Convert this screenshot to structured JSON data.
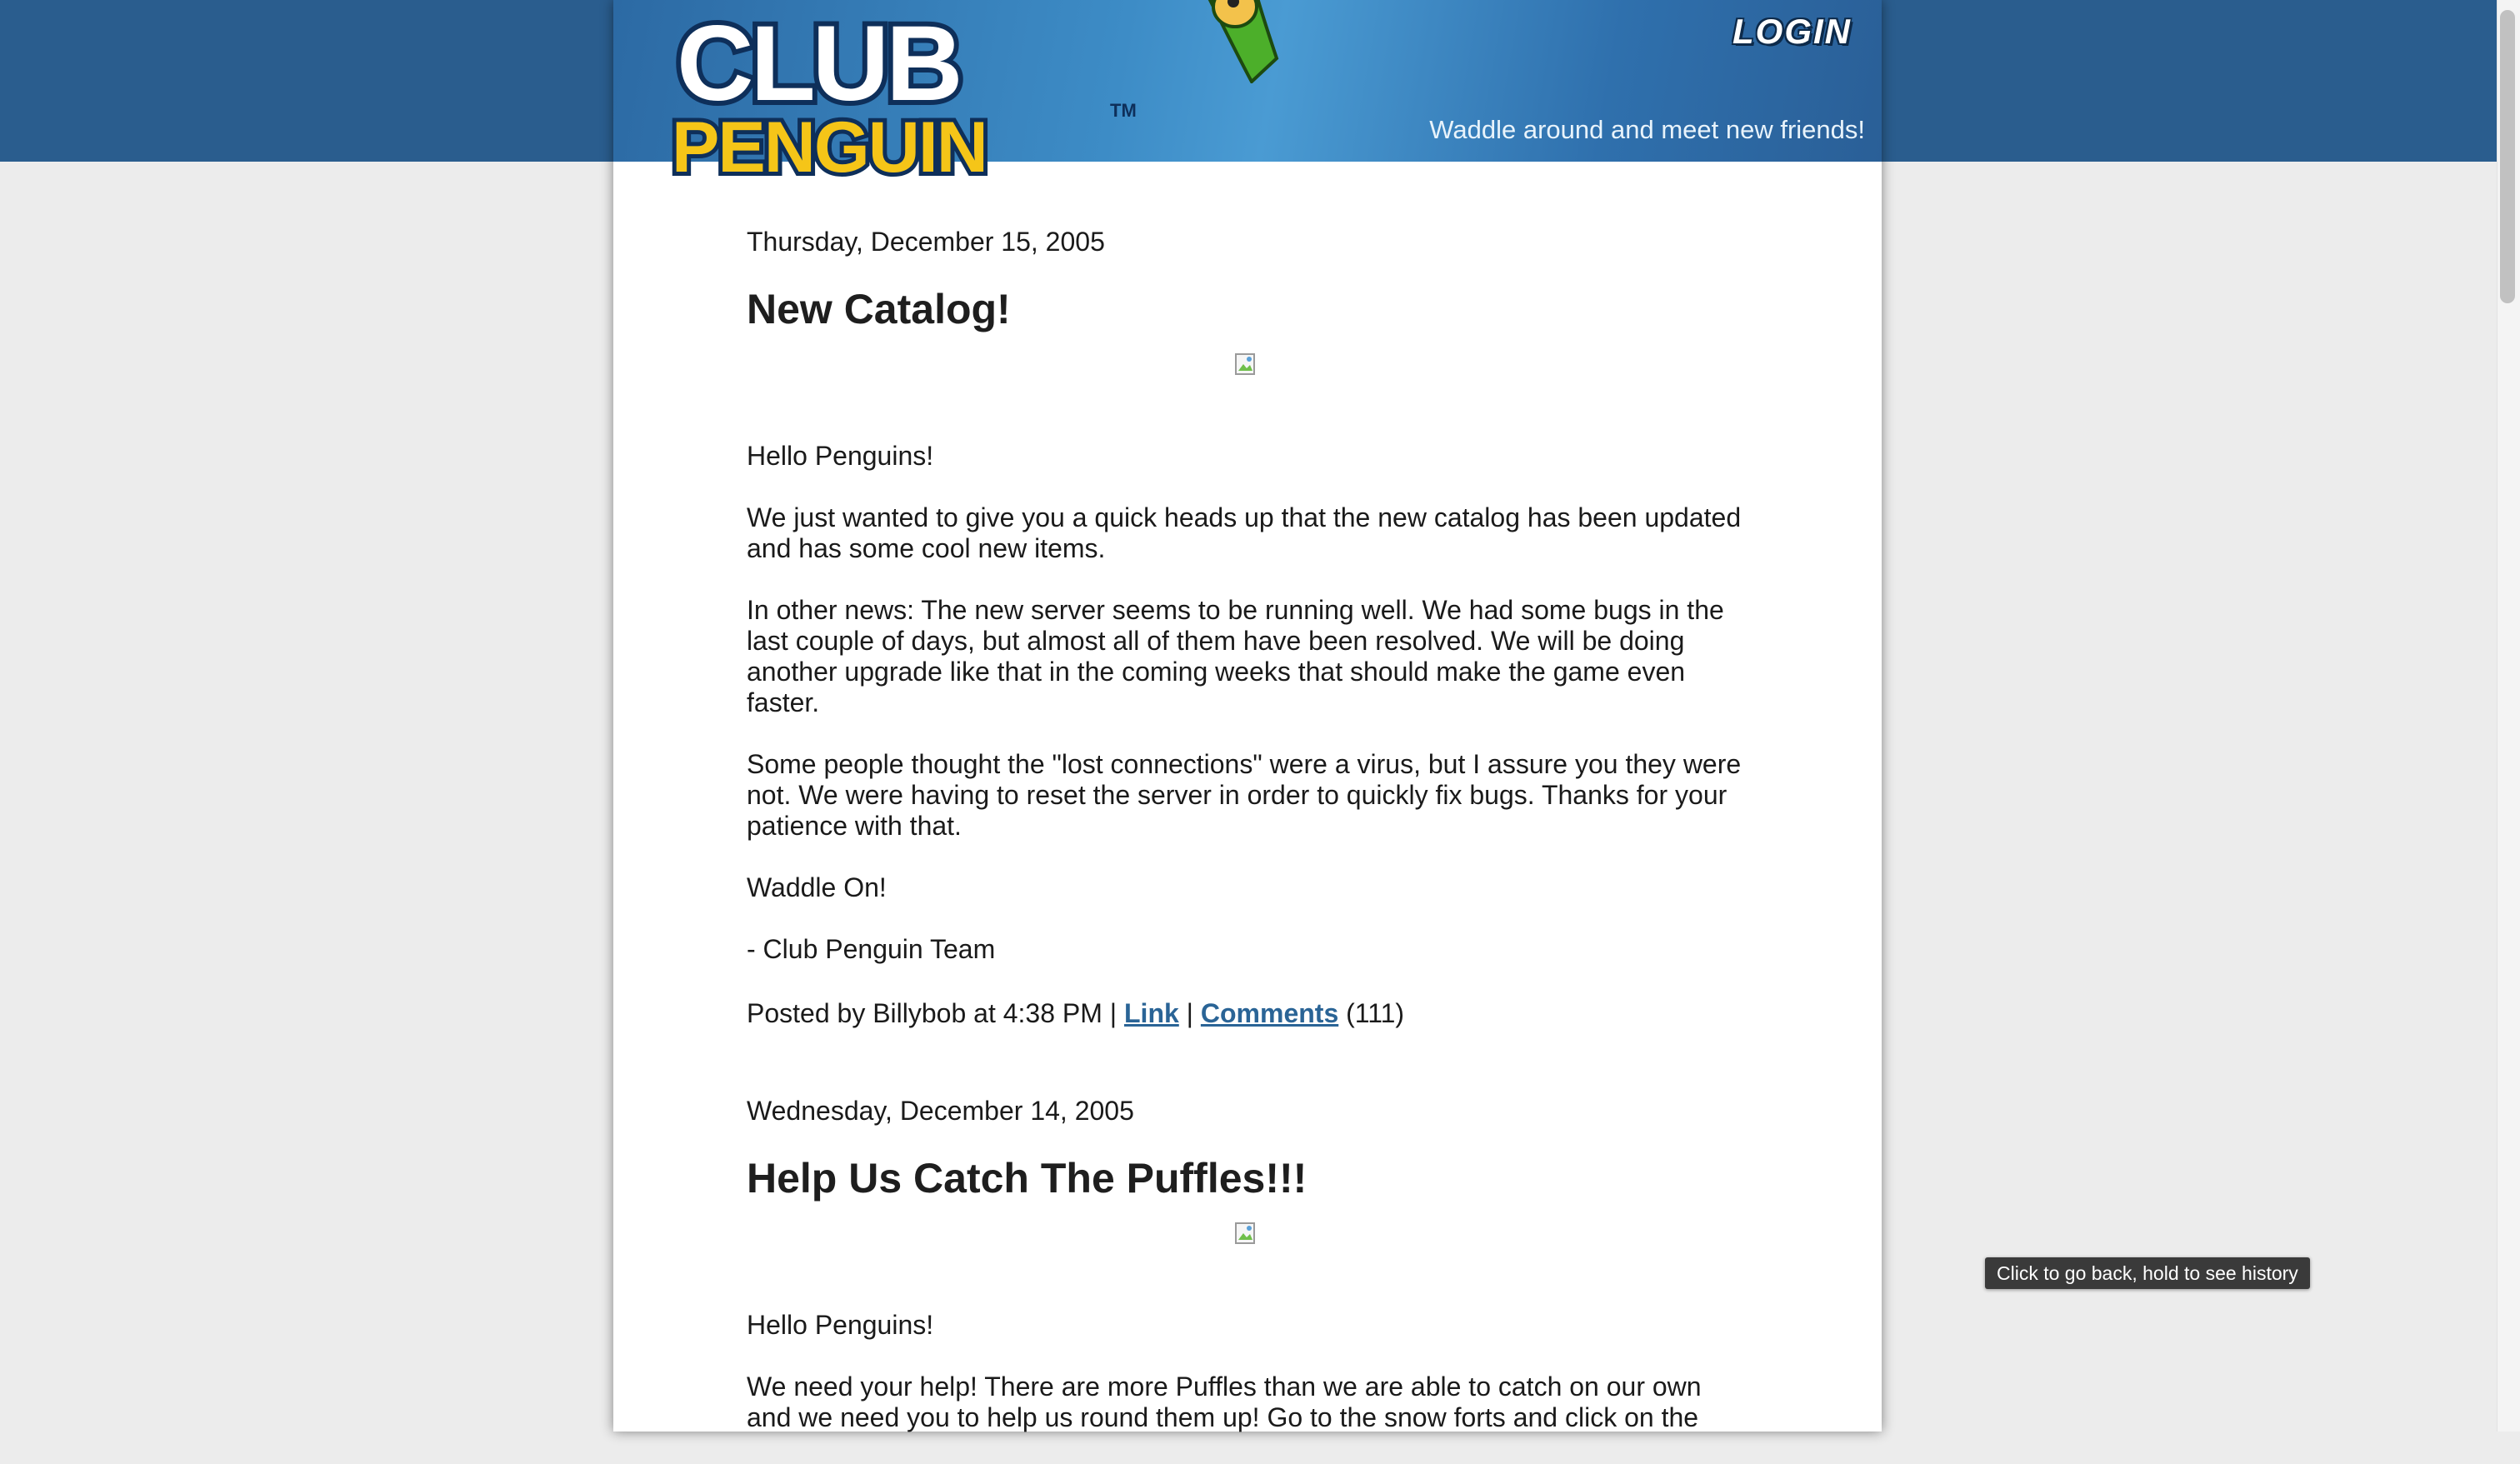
{
  "header": {
    "logo_text_line1": "CLUB",
    "logo_text_line2": "PENGUIN",
    "trademark": "TM",
    "login_label": "LOGIN",
    "tagline": "Waddle around and meet new friends!"
  },
  "posts": [
    {
      "date": "Thursday, December 15, 2005",
      "title": "New Catalog!",
      "paragraphs": [
        "Hello Penguins!",
        "We just wanted to give you a quick heads up that the new catalog has been updated and has some cool new items.",
        "In other news: The new server seems to be running well. We had some bugs in the last couple of days, but almost all of them have been resolved. We will be doing another upgrade like that in the coming weeks that should make the game even faster.",
        "Some people thought the \"lost connections\" were a virus, but I assure you they were not. We were having to reset the server in order to quickly fix bugs. Thanks for your patience with that.",
        "Waddle On!",
        "- Club Penguin Team"
      ],
      "posted_prefix": "Posted by Billybob at 4:38 PM |",
      "link_label": "Link",
      "separator": "|",
      "comments_label": "Comments",
      "comments_count": "(111)"
    },
    {
      "date": "Wednesday, December 14, 2005",
      "title": "Help Us Catch The Puffles!!!",
      "paragraphs": [
        "Hello Penguins!",
        "We need your help! There are more Puffles than we are able to catch on our own and we need you to help us round them up! Go to the snow forts and click on the"
      ]
    }
  ],
  "tooltip": "Click to go back, hold to see history",
  "colors": {
    "header_blue": "#2a5d8e",
    "link": "#2a6496",
    "logo_yellow": "#f5c518",
    "logo_navy": "#0e2f5a"
  },
  "icons": [
    "broken-image-icon",
    "puffle-icon"
  ]
}
